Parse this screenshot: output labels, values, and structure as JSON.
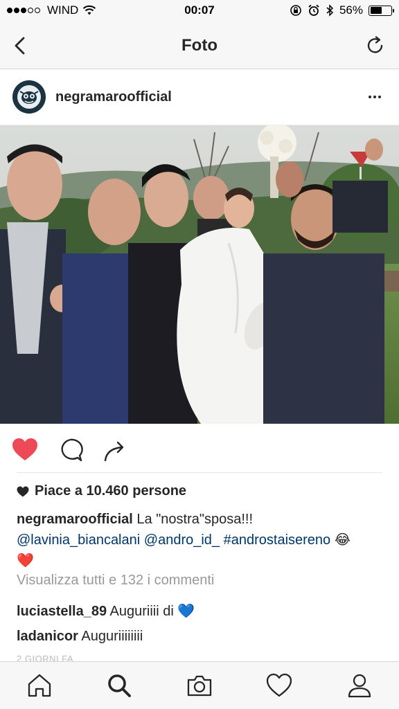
{
  "status_bar": {
    "carrier": "WIND",
    "time": "00:07",
    "battery": "56%",
    "battery_level": 0.56
  },
  "nav": {
    "title": "Foto"
  },
  "post": {
    "username": "negramaroofficial",
    "likes_text": "Piace a 10.460 persone",
    "caption": {
      "username": "negramaroofficial",
      "text": "La \"nostra\"sposa!!!",
      "mention1": "@lavinia_biancalani",
      "mention2": "@andro_id_",
      "hashtag": "#androstaisereno",
      "emoji1": "😂",
      "emoji2": "❤️"
    },
    "view_all_comments": "Visualizza tutti e 132 i commenti",
    "comments": [
      {
        "username": "luciastella_89",
        "text": "Auguriiii di",
        "emoji": "💙"
      },
      {
        "username": "ladanicor",
        "text": "Auguriiiiiiii"
      }
    ],
    "timestamp": "2 GIORNI FA"
  },
  "colors": {
    "like_red": "#ed4956",
    "link_blue": "#003569",
    "bar_bg": "#f7f7f7"
  },
  "icons": {
    "back": "chevron-left-icon",
    "refresh": "refresh-icon",
    "more": "more-horizontal-icon",
    "like": "heart-filled-icon",
    "comment": "comment-bubble-icon",
    "share": "share-arrow-icon",
    "home": "home-icon",
    "search": "search-icon",
    "camera": "camera-icon",
    "activity": "heart-outline-icon",
    "profile": "profile-icon"
  }
}
